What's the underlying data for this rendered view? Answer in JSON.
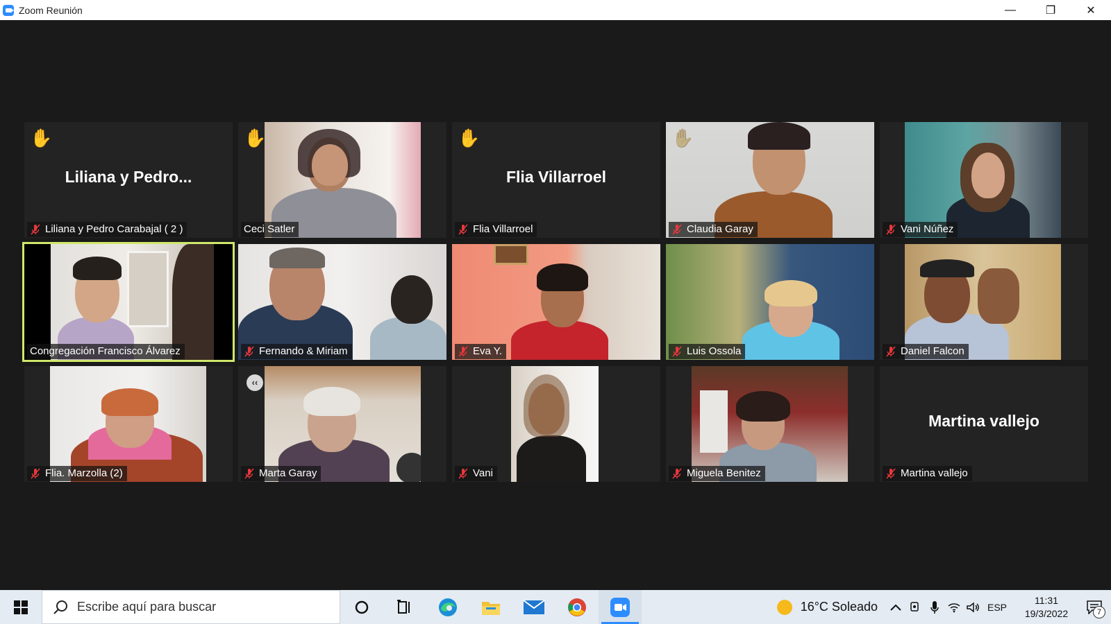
{
  "window": {
    "title": "Zoom Reunión",
    "minimize_glyph": "—",
    "maximize_glyph": "❐",
    "close_glyph": "✕"
  },
  "participants": [
    {
      "label": "Liliana y Pedro Carabajal  ( 2 )",
      "big_name": "Liliana  y  Pedro...",
      "muted": true,
      "hand": "raised"
    },
    {
      "label": "Ceci Satler",
      "muted": false,
      "hand": "raised"
    },
    {
      "label": "Flia Villarroel",
      "big_name": "Flia Villarroel",
      "muted": true,
      "hand": "raised"
    },
    {
      "label": "Claudia Garay",
      "muted": true,
      "hand": "raised-dim"
    },
    {
      "label": "Vani Núñez",
      "muted": true
    },
    {
      "label": "Congregación Francisco Álvarez",
      "muted": false,
      "active_speaker": true
    },
    {
      "label": "Fernando & Miriam",
      "muted": true
    },
    {
      "label": "Eva Y.",
      "muted": true
    },
    {
      "label": "Luis Ossola",
      "muted": true
    },
    {
      "label": "Daniel Falcon",
      "muted": true
    },
    {
      "label": "Flia. Marzolla (2)",
      "muted": true
    },
    {
      "label": "Marta Garay",
      "muted": true,
      "collapse_glyph": "‹‹"
    },
    {
      "label": "Vani",
      "muted": true
    },
    {
      "label": "Miguela Benitez",
      "muted": true
    },
    {
      "label": "Martina vallejo",
      "big_name": "Martina vallejo",
      "muted": true
    }
  ],
  "icons": {
    "hand": "✋",
    "mic_muted": "mic-muted-icon"
  },
  "colors": {
    "active_speaker_border": "#cfe86b",
    "muted_mic": "#e8383d",
    "zoom_blue": "#2d8cff",
    "taskbar_bg": "#e4ebf3"
  },
  "taskbar": {
    "search_placeholder": "Escribe aquí para buscar",
    "weather": "16°C  Soleado",
    "language": "ESP",
    "time": "11:31",
    "date": "19/3/2022",
    "notification_count": "7"
  }
}
